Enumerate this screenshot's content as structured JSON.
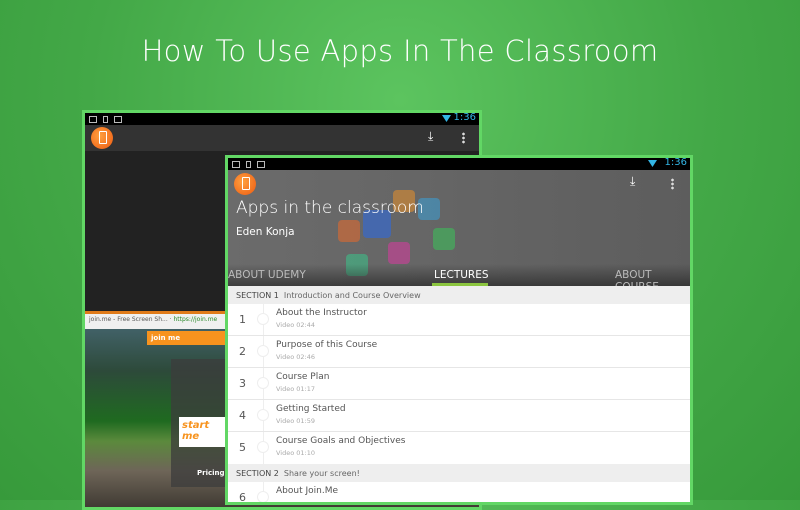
{
  "headline": "How To Use Apps In The Classroom",
  "status": {
    "time": "1:36"
  },
  "back": {
    "browser_tab": "join.me - Free Screen Sh...",
    "url": "https://join.me",
    "brand": "join me",
    "start": "start me",
    "pricing": "Pricing"
  },
  "course": {
    "title": "Apps in the classroom",
    "author": "Eden Konja"
  },
  "tabs": [
    {
      "label": "ABOUT UDEMY"
    },
    {
      "label": "LECTURES"
    },
    {
      "label": "ABOUT COURSE"
    }
  ],
  "sections": [
    {
      "label": "SECTION 1",
      "title": "Introduction and Course Overview"
    },
    {
      "label": "SECTION 2",
      "title": "Share your screen!"
    }
  ],
  "lectures": [
    {
      "num": "1",
      "title": "About the Instructor",
      "sub": "Video 02:44"
    },
    {
      "num": "2",
      "title": "Purpose of this Course",
      "sub": "Video 02:46"
    },
    {
      "num": "3",
      "title": "Course Plan",
      "sub": "Video 01:17"
    },
    {
      "num": "4",
      "title": "Getting Started",
      "sub": "Video 01:59"
    },
    {
      "num": "5",
      "title": "Course Goals and Objectives",
      "sub": "Video 01:10"
    },
    {
      "num": "6",
      "title": "About Join.Me",
      "sub": ""
    }
  ],
  "colors": {
    "accent": "#8bc53f",
    "border": "#62d765",
    "status_blue": "#33b5e5"
  }
}
